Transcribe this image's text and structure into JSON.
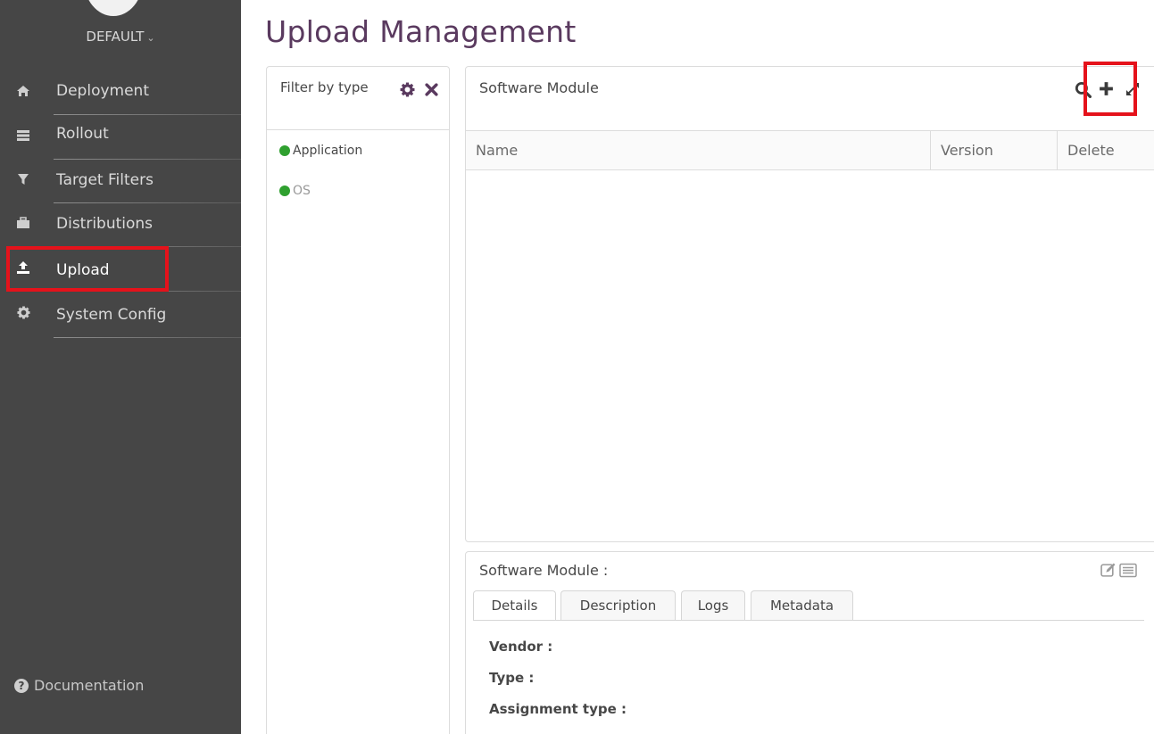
{
  "sidebar": {
    "tenant": "DEFAULT",
    "items": [
      {
        "label": "Deployment",
        "icon": "home-icon"
      },
      {
        "label": "Rollout",
        "icon": "list-icon"
      },
      {
        "label": "Target Filters",
        "icon": "filter-icon"
      },
      {
        "label": "Distributions",
        "icon": "briefcase-icon"
      },
      {
        "label": "Upload",
        "icon": "upload-icon"
      },
      {
        "label": "System Config",
        "icon": "gear-icon"
      }
    ],
    "documentation": "Documentation"
  },
  "page": {
    "title": "Upload Management"
  },
  "filter_panel": {
    "title": "Filter by type",
    "types": [
      {
        "label": "Application",
        "color": "#2fa02f"
      },
      {
        "label": "OS",
        "color": "#2fa02f"
      }
    ]
  },
  "software_module_panel": {
    "title": "Software Module",
    "columns": [
      "Name",
      "Version",
      "Delete"
    ]
  },
  "detail_panel": {
    "title": "Software Module :",
    "tabs": [
      "Details",
      "Description",
      "Logs",
      "Metadata"
    ],
    "fields": [
      "Vendor :",
      "Type :",
      "Assignment type :"
    ]
  },
  "colors": {
    "sidebar_bg": "#464646",
    "title_purple": "#5a3a5f",
    "highlight_red": "#e5121b",
    "type_green": "#2fa02f"
  }
}
